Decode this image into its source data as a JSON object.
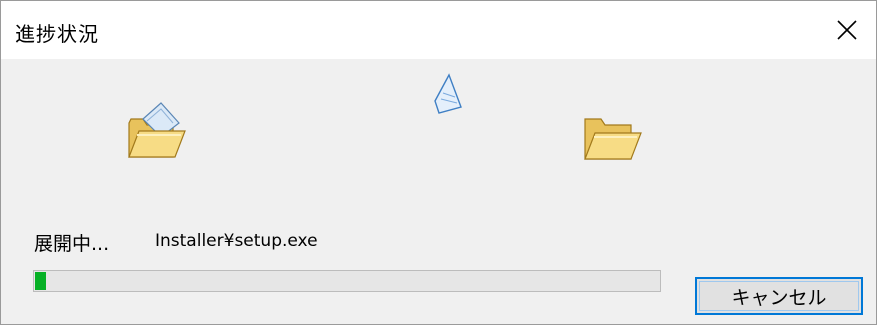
{
  "window": {
    "title": "進捗状況",
    "close_icon": "close-icon"
  },
  "animation": {
    "source_icon": "open-folder-with-paper-icon",
    "flying_icon": "flying-paper-icon",
    "destination_icon": "open-folder-icon"
  },
  "status": {
    "label": "展開中...",
    "file": "Installer¥setup.exe"
  },
  "progress": {
    "value_percent": 2,
    "color": "#06b025"
  },
  "buttons": {
    "cancel_label": "キャンセル",
    "focus_color": "#0078d7"
  }
}
